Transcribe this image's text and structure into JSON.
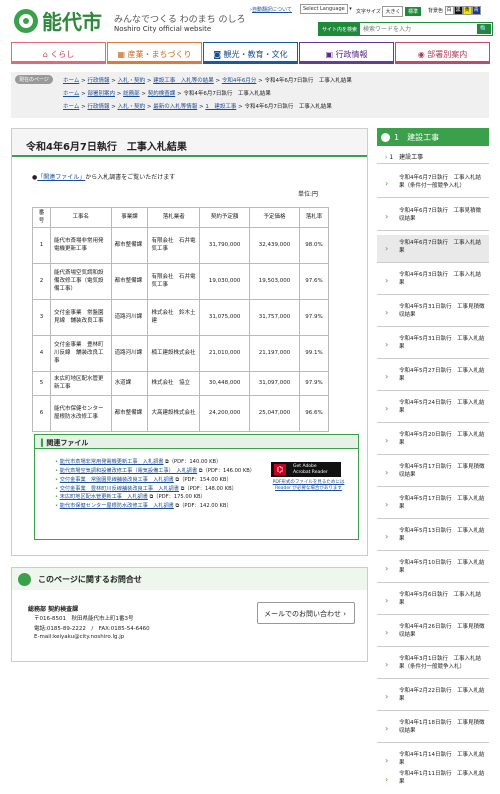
{
  "header": {
    "site_title": "能代市",
    "catchphrase": "みんなでつくる わのまち のしろ",
    "subtitle": "Noshiro City official website",
    "auto_translate_link": "自動翻訳について",
    "language_select": "Select Language",
    "font_size_label": "文字サイズ",
    "font_size_large": "大きく",
    "font_size_standard": "標準",
    "bg_color_label": "背景色",
    "bg_options": [
      "白",
      "黒",
      "黄",
      "青"
    ],
    "search_label": "サイト内を検索",
    "search_placeholder": "検索ワードを入力",
    "search_button": "🔍"
  },
  "gnav": [
    "くらし",
    "産業・まちづくり",
    "観光・教育・文化",
    "行政情報",
    "部署別案内"
  ],
  "breadcrumbs": {
    "here_label": "現在のページ",
    "rows": [
      [
        "ホーム",
        "行政情報",
        "入札・契約",
        "建設工事　入札等の結果",
        "令和4年6月分",
        "令和4年6月7日執行　工事入札結果"
      ],
      [
        "ホーム",
        "部署別案内",
        "総務部",
        "契約検査課",
        "令和4年6月7日執行　工事入札結果"
      ],
      [
        "ホーム",
        "行政情報",
        "入札・契約",
        "最新の入札等情報",
        "1　建設工事",
        "令和4年6月7日執行　工事入札結果"
      ]
    ]
  },
  "page": {
    "title": "令和4年6月7日執行　工事入札結果",
    "announce_link": "「関連ファイル」",
    "announce_text": "から入札調書をご覧いただけます",
    "unit": "単位:円"
  },
  "table": {
    "headers": [
      "番号",
      "工事名",
      "事業課",
      "落札業者",
      "契約予定額",
      "予定価格",
      "落札率"
    ],
    "rows": [
      [
        "1",
        "能代市斎場非常用発電機更新工事",
        "都市整備課",
        "有限会社　石井電気工事",
        "31,790,000",
        "32,439,000",
        "98.0%"
      ],
      [
        "2",
        "能代斎場空気調和設備改修工事（電気設備工事）",
        "都市整備課",
        "有限会社　石井電気工事",
        "19,030,000",
        "19,503,000",
        "97.6%"
      ],
      [
        "3",
        "交付金事業　常盤園見線　舗装改良工事",
        "道路河川課",
        "株式会社　鈴木土建",
        "31,075,000",
        "31,757,000",
        "97.9%"
      ],
      [
        "4",
        "交付金事業　豊林町川反線　舗装改良工事",
        "道路河川課",
        "楠工建設株式会社",
        "21,010,000",
        "21,197,000",
        "99.1%"
      ],
      [
        "5",
        "末広町地区配水管更新工事",
        "水道課",
        "株式会社　協立",
        "30,448,000",
        "31,097,000",
        "97.9%"
      ],
      [
        "6",
        "能代市保健センター屋根防水改修工事",
        "都市整備課",
        "大髙建設株式会社",
        "24,200,000",
        "25,047,000",
        "96.6%"
      ]
    ]
  },
  "related": {
    "heading": "関連ファイル",
    "files": [
      {
        "name": "能代市斎場非常用発電機更新工事　入札調書",
        "meta": "（PDF：140.00 KB）"
      },
      {
        "name": "能代斎場空気調和設備改修工事（電気設備工事）　入札調書",
        "meta": "（PDF：146.00 KB）"
      },
      {
        "name": "交付金事業　常盤園見線舗装改良工事　入札調書",
        "meta": "（PDF：154.00 KB）"
      },
      {
        "name": "交付金事業　豊林町川反線舗装改良工事　入札調書",
        "meta": "（PDF：148.00 KB）"
      },
      {
        "name": "末広町地区配水管更新工事　入札調書",
        "meta": "（PDF：175.00 KB）"
      },
      {
        "name": "能代市保健センター屋根防水改修工事　入札調書",
        "meta": "（PDF：142.00 KB）"
      }
    ],
    "acrobat_line1": "Get Adobe",
    "acrobat_line2": "Acrobat Reader",
    "acrobat_note": "PDF形式のファイルを見るためにはReader が必要な場合があります"
  },
  "contact": {
    "heading": "このページに関するお問合せ",
    "dept": "総務部 契約検査課",
    "address": "〒016-8501　秋田県能代市上町1番3号",
    "phone": "電話:0185-89-2222　/　FAX:0185-54-6460",
    "email": "E-mail:keiyaku@city.noshiro.lg.jp",
    "mail_button": "メールでのお問い合わせ"
  },
  "sidebar": {
    "heading": "1　建設工事",
    "current": "1　建設工事",
    "items": [
      "令和4年6月7日執行　工事入札結果（条件付一般競争入札）",
      "令和4年6月7日執行　工事見積徴収結果",
      "令和4年6月7日執行　工事入札結果",
      "令和4年6月3日執行　工事入札結果",
      "令和4年5月31日執行　工事見積徴収結果",
      "令和4年5月31日執行　工事入札結果",
      "令和4年5月27日執行　工事入札結果",
      "令和4年5月24日執行　工事入札結果",
      "令和4年5月20日執行　工事入札結果",
      "令和4年5月17日執行　工事見積徴収結果",
      "令和4年5月17日執行　工事入札結果",
      "令和4年5月13日執行　工事入札結果",
      "令和4年5月10日執行　工事入札結果",
      "令和4年5月6日執行　工事入札結果",
      "令和4年4月26日執行　工事見積徴収結果",
      "令和4年3月1日執行　工事入札結果（条件付一般競争入札）",
      "令和4年2月22日執行　工事入札結果",
      "令和4年1月18日執行　工事見積徴収結果",
      "令和4年1月14日執行　工事入札結果",
      "令和4年1月11日執行　工事入札結果"
    ]
  },
  "colors": {
    "brand_green": "#3aa04a",
    "link": "#1a4d9c"
  }
}
